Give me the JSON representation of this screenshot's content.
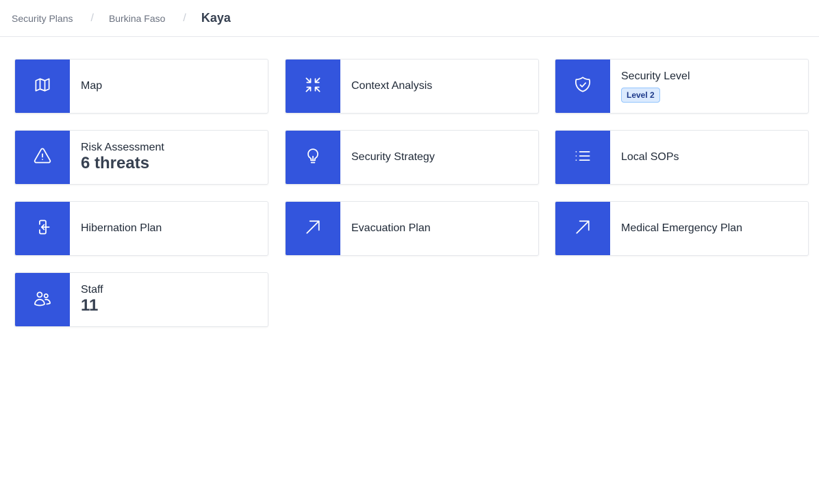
{
  "breadcrumb": {
    "items": [
      "Security Plans",
      "Burkina Faso"
    ],
    "separator": "/",
    "current": "Kaya"
  },
  "theme": {
    "tile_color": "#3355dd",
    "badge_bg": "#dbeafe"
  },
  "cards": {
    "map": {
      "label": "Map",
      "icon": "map-icon"
    },
    "context": {
      "label": "Context Analysis",
      "icon": "arrows-pointing-in-icon"
    },
    "security_level": {
      "label": "Security Level",
      "badge": "Level 2",
      "icon": "shield-check-icon"
    },
    "risk": {
      "label": "Risk Assessment",
      "value": "6 threats",
      "icon": "warning-triangle-icon"
    },
    "strategy": {
      "label": "Security Strategy",
      "icon": "light-bulb-icon"
    },
    "sops": {
      "label": "Local SOPs",
      "icon": "list-icon"
    },
    "hibernation": {
      "label": "Hibernation Plan",
      "icon": "enter-door-icon"
    },
    "evacuation": {
      "label": "Evacuation Plan",
      "icon": "arrow-up-right-icon"
    },
    "medical": {
      "label": "Medical Emergency Plan",
      "icon": "arrow-up-right-icon"
    },
    "staff": {
      "label": "Staff",
      "value": "11",
      "icon": "users-icon"
    }
  }
}
